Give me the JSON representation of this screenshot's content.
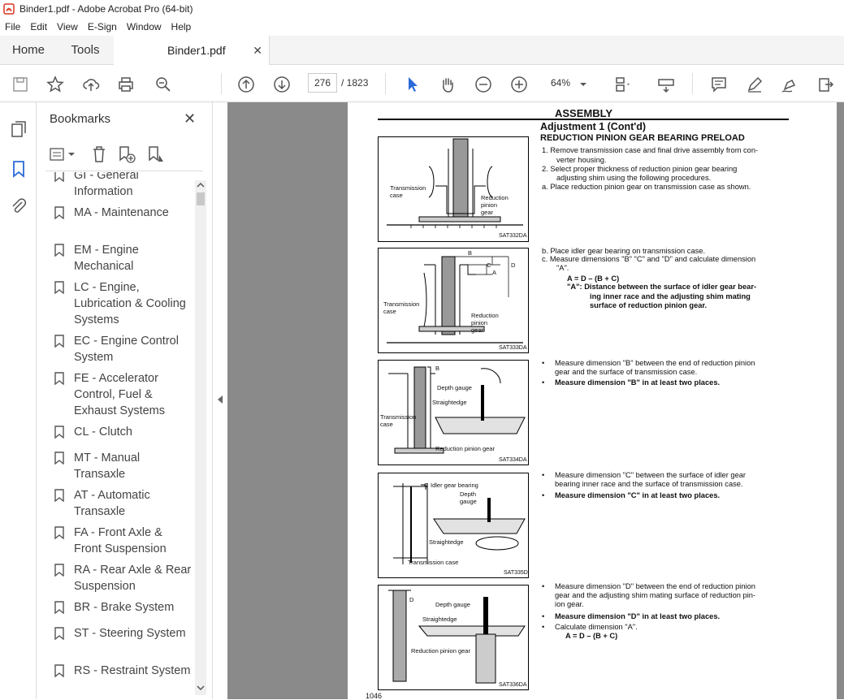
{
  "window": {
    "title": "Binder1.pdf - Adobe Acrobat Pro (64-bit)"
  },
  "menu": [
    "File",
    "Edit",
    "View",
    "E-Sign",
    "Window",
    "Help"
  ],
  "tabs": {
    "home": "Home",
    "tools": "Tools",
    "document": "Binder1.pdf"
  },
  "toolbar": {
    "page_current": "276",
    "page_total": "/ 1823",
    "zoom": "64%"
  },
  "bookmarks": {
    "title": "Bookmarks",
    "items": [
      "GI - General Information",
      "MA - Maintenance",
      "EM - Engine Mechanical",
      "LC - Engine, Lubrication & Cooling Systems",
      "EC - Engine Control System",
      "FE - Accelerator Control, Fuel & Exhaust Systems",
      "CL - Clutch",
      "MT - Manual Transaxle",
      "AT - Automatic Transaxle",
      "FA - Front Axle & Front Suspension",
      "RA - Rear Axle & Rear Suspension",
      "BR - Brake System",
      "ST - Steering System",
      "RS - Restraint System"
    ]
  },
  "pdf": {
    "section": "ASSEMBLY",
    "heading": "Adjustment 1 (Cont'd)",
    "subheading": "REDUCTION PINION GEAR BEARING PRELOAD",
    "step1": "1.  Remove transmission case and final drive assembly from con-",
    "step1b": "verter housing.",
    "step2": "2.  Select proper thickness of reduction pinion gear bearing",
    "step2b": "adjusting shim using the following procedures.",
    "stepa": "a.  Place reduction pinion gear on transmission case as shown.",
    "stepb": "b.  Place idler gear bearing on transmission case.",
    "stepc": "c.  Measure dimensions \"B\" \"C\" and \"D\" and calculate dimension",
    "stepc2": "\"A\".",
    "formula": "A = D – (B + C)",
    "def1": "\"A\":  Distance between the surface of idler gear bear-",
    "def2": "ing inner race and the adjusting shim mating",
    "def3": "surface of reduction pinion gear.",
    "b1": "Measure dimension \"B\" between the end of reduction pinion",
    "b1b": "gear and the surface of transmission case.",
    "b2": "Measure dimension \"B\" in at least two places.",
    "c1": "Measure dimension \"C\" between the surface of idler gear",
    "c1b": "bearing inner race and the surface of transmission case.",
    "c2": "Measure dimension \"C\" in at least two places.",
    "d1": "Measure dimension \"D\" between the end of reduction pinion",
    "d1b": "gear and the adjusting shim mating surface of reduction pin-",
    "d1c": "ion gear.",
    "d2": "Measure dimension \"D\" in at least two places.",
    "d3": "Calculate dimension \"A\".",
    "d4": "A = D – (B + C)",
    "page_number": "1046",
    "figures": {
      "f1": {
        "code": "SAT332DA",
        "label1": "Transmission",
        "label1b": "case",
        "label2": "Reduction",
        "label2b": "pinion",
        "label2c": "gear"
      },
      "f2": {
        "code": "SAT333DA",
        "label1": "Transmission",
        "label1b": "case",
        "label2": "Reduction",
        "label2b": "pinion",
        "label2c": "gear",
        "b": "B",
        "c": "C",
        "a": "A",
        "d": "D"
      },
      "f3": {
        "code": "SAT334DA",
        "depth": "Depth gauge",
        "straight": "Straightedge",
        "case": "Transmission",
        "caseb": "case",
        "pinion": "Reduction pinion gear",
        "b": "B"
      },
      "f4": {
        "code": "SAT335D",
        "idler": "Idler gear bearing",
        "depth": "Depth",
        "depthb": "gauge",
        "straight": "Straightedge",
        "case": "Transmission case",
        "c": "C"
      },
      "f5": {
        "code": "SAT336DA",
        "depth": "Depth gauge",
        "straight": "Straightedge",
        "pinion": "Reduction pinion gear",
        "d": "D"
      }
    }
  }
}
